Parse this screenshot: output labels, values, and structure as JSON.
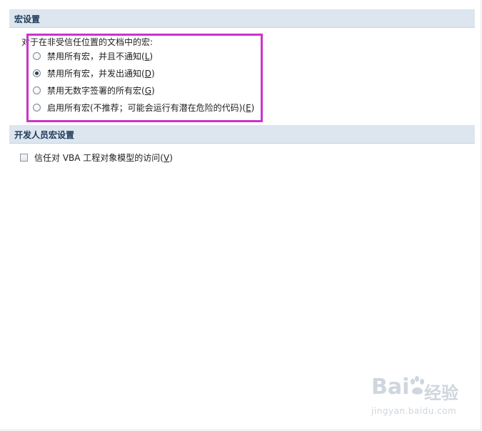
{
  "macro_section": {
    "title": "宏设置",
    "intro": "对于在非受信任位置的文档中的宏:",
    "options": [
      {
        "label": "禁用所有宏，并且不通知",
        "hotkey": "L",
        "checked": false
      },
      {
        "label": "禁用所有宏，并发出通知",
        "hotkey": "D",
        "checked": true
      },
      {
        "label": "禁用无数字签署的所有宏",
        "hotkey": "G",
        "checked": false
      },
      {
        "label": "启用所有宏(不推荐；可能会运行有潜在危险的代码)",
        "hotkey": "E",
        "checked": false
      }
    ]
  },
  "developer_section": {
    "title": "开发人员宏设置",
    "checkbox": {
      "label": "信任对 VBA 工程对象模型的访问",
      "hotkey": "V",
      "checked": false
    }
  },
  "watermark": {
    "logo_text": "Bai",
    "cn_text": "经验",
    "url": "jingyan.baidu.com"
  },
  "colors": {
    "header_bg": "#dde6ee",
    "highlight": "#cc33cc"
  }
}
